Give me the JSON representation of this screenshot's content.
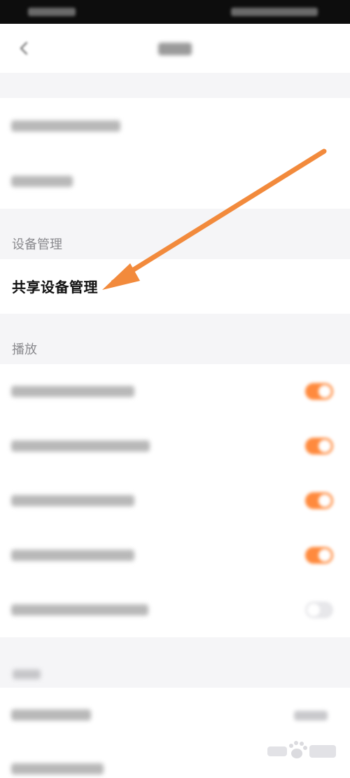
{
  "sections": {
    "device_management": {
      "header": "设备管理",
      "items": [
        {
          "label": "共享设备管理"
        }
      ]
    },
    "playback": {
      "header": "播放",
      "toggles": [
        {
          "state": "on"
        },
        {
          "state": "on"
        },
        {
          "state": "on"
        },
        {
          "state": "on"
        },
        {
          "state": "off"
        }
      ]
    }
  },
  "colors": {
    "accent": "#ff8a3d",
    "arrow": "#f28a3c",
    "background": "#f5f5f7",
    "row": "#ffffff"
  },
  "icons": {
    "back": "chevron-left-icon",
    "arrow": "annotation-arrow-icon",
    "watermark": "paw-print-icon"
  }
}
